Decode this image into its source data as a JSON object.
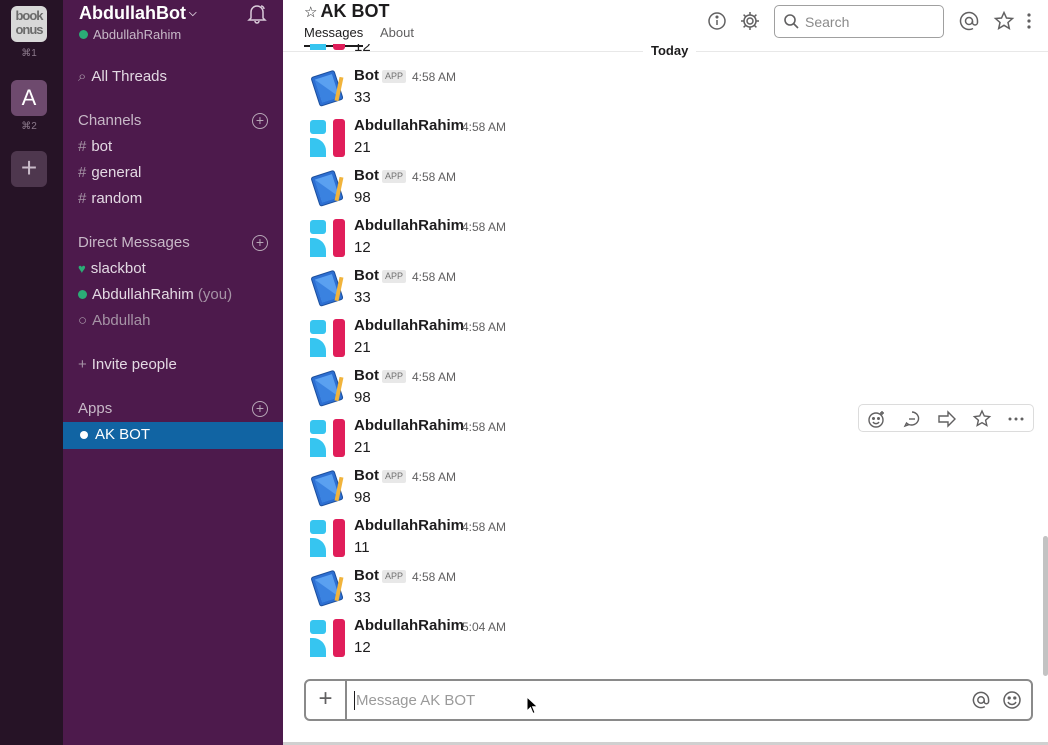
{
  "workspaces": [
    {
      "logo_text": "book onus",
      "shortcut": "⌘1"
    },
    {
      "letter": "A",
      "shortcut": "⌘2"
    }
  ],
  "sidebar": {
    "team_name": "AbdullahBot",
    "user_name": "AbdullahRahim",
    "all_threads": "All Threads",
    "channels_header": "Channels",
    "channels": [
      "bot",
      "general",
      "random"
    ],
    "dm_header": "Direct Messages",
    "dms": [
      {
        "name": "slackbot",
        "suffix": ""
      },
      {
        "name": "AbdullahRahim",
        "suffix": "(you)"
      },
      {
        "name": "Abdullah",
        "suffix": ""
      }
    ],
    "invite": "Invite people",
    "apps_header": "Apps",
    "apps": [
      "AK BOT"
    ]
  },
  "header": {
    "title": "AK BOT",
    "tabs": [
      "Messages",
      "About"
    ],
    "search_placeholder": "Search"
  },
  "messages": {
    "day_divider": "Today",
    "partial_text": "12",
    "app_badge": "APP",
    "items": [
      {
        "sender": "Bot",
        "app": true,
        "time": "4:58 AM",
        "text": "33"
      },
      {
        "sender": "AbdullahRahim",
        "app": false,
        "time": "4:58 AM",
        "text": "21"
      },
      {
        "sender": "Bot",
        "app": true,
        "time": "4:58 AM",
        "text": "98"
      },
      {
        "sender": "AbdullahRahim",
        "app": false,
        "time": "4:58 AM",
        "text": "12"
      },
      {
        "sender": "Bot",
        "app": true,
        "time": "4:58 AM",
        "text": "33"
      },
      {
        "sender": "AbdullahRahim",
        "app": false,
        "time": "4:58 AM",
        "text": "21"
      },
      {
        "sender": "Bot",
        "app": true,
        "time": "4:58 AM",
        "text": "98"
      },
      {
        "sender": "AbdullahRahim",
        "app": false,
        "time": "4:58 AM",
        "text": "21"
      },
      {
        "sender": "Bot",
        "app": true,
        "time": "4:58 AM",
        "text": "98"
      },
      {
        "sender": "AbdullahRahim",
        "app": false,
        "time": "4:58 AM",
        "text": "11"
      },
      {
        "sender": "Bot",
        "app": true,
        "time": "4:58 AM",
        "text": "33"
      },
      {
        "sender": "AbdullahRahim",
        "app": false,
        "time": "5:04 AM",
        "text": "12"
      }
    ]
  },
  "composer": {
    "placeholder": "Message AK BOT"
  },
  "colors": {
    "rail": "#261326",
    "sidebar": "#4d1a4c",
    "active": "#1164a3",
    "presence": "#2bac76"
  },
  "icons": [
    "bell-icon",
    "info-icon",
    "gear-icon",
    "search-icon",
    "mentions-icon",
    "star-icon",
    "more-icon",
    "emoji-icon",
    "thread-icon",
    "share-icon",
    "add-icon"
  ]
}
